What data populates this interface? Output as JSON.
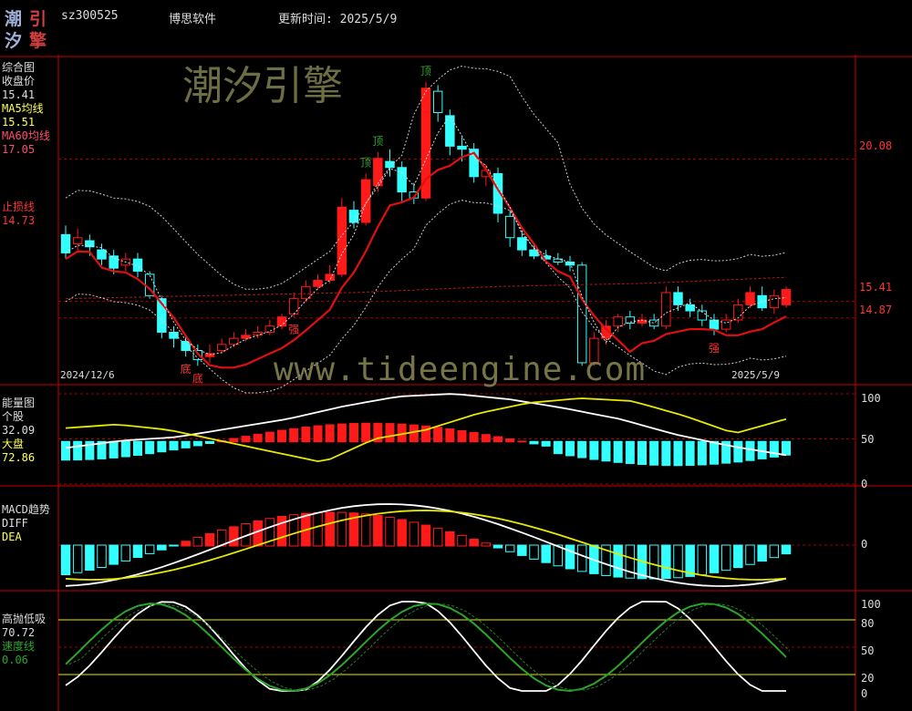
{
  "header": {
    "logo_chars": [
      "潮",
      "引",
      "汐",
      "擎"
    ],
    "code": "sz300525",
    "name": "博思软件",
    "update_label": "更新时间: 2025/5/9"
  },
  "watermark": {
    "top_text": "潮汐引擎",
    "url_text": "www.tideengine.com"
  },
  "colors": {
    "up": "#ff1a1a",
    "down": "#33ffff",
    "ma5": "#ffff55",
    "ma60": "#ff4444",
    "stop": "#ff3333",
    "grid": "#a80000",
    "border": "#cc0000",
    "speed": "#2aa52a",
    "yellowline": "#e8e800"
  },
  "panels": {
    "main": {
      "title": "综合图",
      "close_label": "收盘价",
      "close_value": "15.41",
      "ma5_label": "MA5均线",
      "ma5_value": "15.51",
      "ma60_label": "MA60均线",
      "ma60_value": "17.05",
      "stop_label": "止损线",
      "stop_value": "14.73",
      "right_levels": [
        "20.08",
        "15.41",
        "14.87"
      ],
      "date_left": "2024/12/6",
      "date_right": "2025/5/9",
      "annotations": [
        {
          "text": "底",
          "kind": "bottom",
          "idx": 10
        },
        {
          "text": "底",
          "kind": "bottom",
          "idx": 11
        },
        {
          "text": "强",
          "kind": "strong",
          "idx": 19
        },
        {
          "text": "顶",
          "kind": "top",
          "idx": 25
        },
        {
          "text": "顶",
          "kind": "top",
          "idx": 26
        },
        {
          "text": "顶",
          "kind": "top",
          "idx": 30
        },
        {
          "text": "强",
          "kind": "strong",
          "idx": 54
        }
      ]
    },
    "energy": {
      "title": "能量图",
      "stock_label": "个股",
      "stock_value": "32.09",
      "market_label": "大盘",
      "market_value": "72.86",
      "right_levels": [
        "100",
        "50",
        "0"
      ]
    },
    "macd": {
      "title": "MACD趋势",
      "diff_label": "DIFF",
      "dea_label": "DEA",
      "right_levels": [
        "0"
      ]
    },
    "kd": {
      "title": "高抛低吸",
      "value": "70.72",
      "speed_label": "速度线",
      "speed_value": "0.06",
      "right_levels": [
        "100",
        "80",
        "50",
        "20",
        "0"
      ]
    }
  },
  "chart_data": {
    "type": "candlestick",
    "x_start": "2024/12/6",
    "x_end": "2025/5/9",
    "y_price_range": [
      12.8,
      23.2
    ],
    "candles": [
      [
        17.6,
        17.0,
        17.9,
        16.8
      ],
      [
        17.3,
        17.5,
        17.8,
        17.0
      ],
      [
        17.4,
        17.2,
        17.6,
        16.9
      ],
      [
        17.1,
        16.8,
        17.3,
        16.6
      ],
      [
        16.9,
        16.5,
        17.1,
        16.3
      ],
      [
        16.6,
        16.8,
        17.0,
        16.4
      ],
      [
        16.8,
        16.4,
        17.0,
        16.2
      ],
      [
        16.3,
        15.6,
        16.4,
        15.5
      ],
      [
        15.5,
        14.4,
        15.6,
        14.2
      ],
      [
        14.4,
        14.2,
        14.6,
        13.9
      ],
      [
        14.1,
        13.8,
        14.3,
        13.6
      ],
      [
        13.8,
        13.5,
        14.0,
        13.3
      ],
      [
        13.6,
        13.7,
        14.0,
        13.4
      ],
      [
        13.8,
        14.0,
        14.2,
        13.7
      ],
      [
        14.0,
        14.2,
        14.4,
        13.9
      ],
      [
        14.2,
        14.3,
        14.5,
        14.1
      ],
      [
        14.3,
        14.4,
        14.6,
        14.2
      ],
      [
        14.4,
        14.6,
        14.8,
        14.3
      ],
      [
        14.6,
        14.9,
        15.0,
        14.5
      ],
      [
        15.0,
        15.5,
        15.7,
        14.9
      ],
      [
        15.5,
        15.9,
        16.1,
        15.4
      ],
      [
        15.9,
        16.1,
        16.3,
        15.8
      ],
      [
        16.1,
        16.3,
        16.6,
        16.0
      ],
      [
        16.3,
        18.5,
        18.8,
        16.2
      ],
      [
        18.4,
        18.0,
        18.7,
        17.8
      ],
      [
        18.0,
        19.4,
        19.6,
        17.9
      ],
      [
        19.2,
        20.1,
        20.3,
        19.0
      ],
      [
        20.0,
        19.8,
        20.4,
        19.5
      ],
      [
        19.8,
        19.0,
        20.0,
        18.7
      ],
      [
        19.0,
        18.8,
        19.3,
        18.6
      ],
      [
        18.8,
        22.4,
        22.6,
        18.7
      ],
      [
        22.3,
        21.6,
        22.5,
        21.3
      ],
      [
        21.5,
        20.5,
        21.7,
        20.2
      ],
      [
        20.5,
        20.4,
        20.8,
        20.0
      ],
      [
        20.4,
        19.5,
        20.6,
        19.3
      ],
      [
        19.5,
        19.7,
        19.9,
        19.2
      ],
      [
        19.6,
        18.3,
        19.8,
        18.0
      ],
      [
        18.2,
        17.5,
        18.4,
        17.2
      ],
      [
        17.5,
        17.1,
        17.7,
        16.9
      ],
      [
        17.1,
        16.9,
        17.3,
        16.8
      ],
      [
        16.9,
        16.8,
        17.1,
        16.7
      ],
      [
        16.8,
        16.7,
        17.0,
        16.6
      ],
      [
        16.7,
        16.6,
        16.9,
        16.4
      ],
      [
        16.6,
        13.4,
        16.7,
        13.3
      ],
      [
        13.4,
        14.2,
        14.4,
        13.3
      ],
      [
        14.2,
        14.6,
        14.8,
        14.0
      ],
      [
        14.6,
        14.9,
        15.0,
        14.4
      ],
      [
        14.9,
        14.7,
        15.1,
        14.5
      ],
      [
        14.7,
        14.8,
        15.0,
        14.6
      ],
      [
        14.8,
        14.6,
        15.0,
        14.5
      ],
      [
        14.6,
        15.7,
        15.9,
        14.5
      ],
      [
        15.7,
        15.3,
        15.9,
        15.1
      ],
      [
        15.3,
        15.1,
        15.5,
        14.9
      ],
      [
        15.1,
        14.8,
        15.3,
        14.6
      ],
      [
        14.8,
        14.5,
        15.0,
        14.3
      ],
      [
        14.5,
        14.8,
        15.0,
        14.4
      ],
      [
        14.8,
        15.3,
        15.5,
        14.7
      ],
      [
        15.3,
        15.7,
        15.9,
        15.2
      ],
      [
        15.6,
        15.2,
        15.9,
        15.1
      ],
      [
        15.2,
        15.6,
        15.8,
        15.0
      ],
      [
        15.3,
        15.8,
        15.9,
        15.2
      ]
    ],
    "ma60": [
      15.5,
      15.6,
      15.7,
      15.9,
      16.0,
      16.2
    ],
    "energy_stock": [
      40,
      48,
      52,
      62,
      72,
      86,
      97,
      100,
      94,
      84,
      72,
      55,
      42,
      32
    ],
    "energy_market": [
      62,
      66,
      60,
      48,
      36,
      24,
      50,
      60,
      78,
      90,
      95,
      92,
      76,
      56,
      72
    ],
    "kd_value_range": [
      0,
      100
    ]
  }
}
